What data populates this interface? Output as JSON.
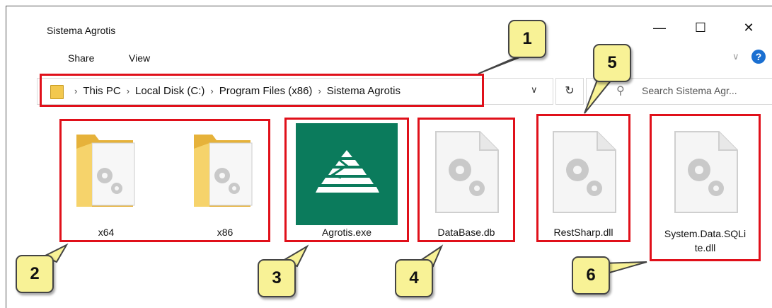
{
  "window": {
    "title": "Sistema Agrotis"
  },
  "ribbon": {
    "tabs": [
      "Share",
      "View"
    ]
  },
  "address_bar": {
    "crumbs": [
      "This PC",
      "Local Disk (C:)",
      "Program Files (x86)",
      "Sistema Agrotis"
    ]
  },
  "search": {
    "placeholder": "Search Sistema Agr..."
  },
  "files": {
    "x64": "x64",
    "x86": "x86",
    "exe": "Agrotis.exe",
    "db": "DataBase.db",
    "restsharp": "RestSharp.dll",
    "sqlite_line1": "System.Data.SQLi",
    "sqlite_line2": "te.dll"
  },
  "callouts": {
    "c1": "1",
    "c2": "2",
    "c3": "3",
    "c4": "4",
    "c5": "5",
    "c6": "6"
  },
  "colors": {
    "highlight": "#e0101a",
    "callout_fill": "#f8f296",
    "agrotis_green": "#0b7b5c",
    "folder": "#f3c84e"
  },
  "icons": {
    "minimize": "minimize-icon",
    "maximize": "maximize-icon",
    "close": "close-icon",
    "refresh": "refresh-icon",
    "search": "search-icon",
    "help": "help-icon"
  }
}
